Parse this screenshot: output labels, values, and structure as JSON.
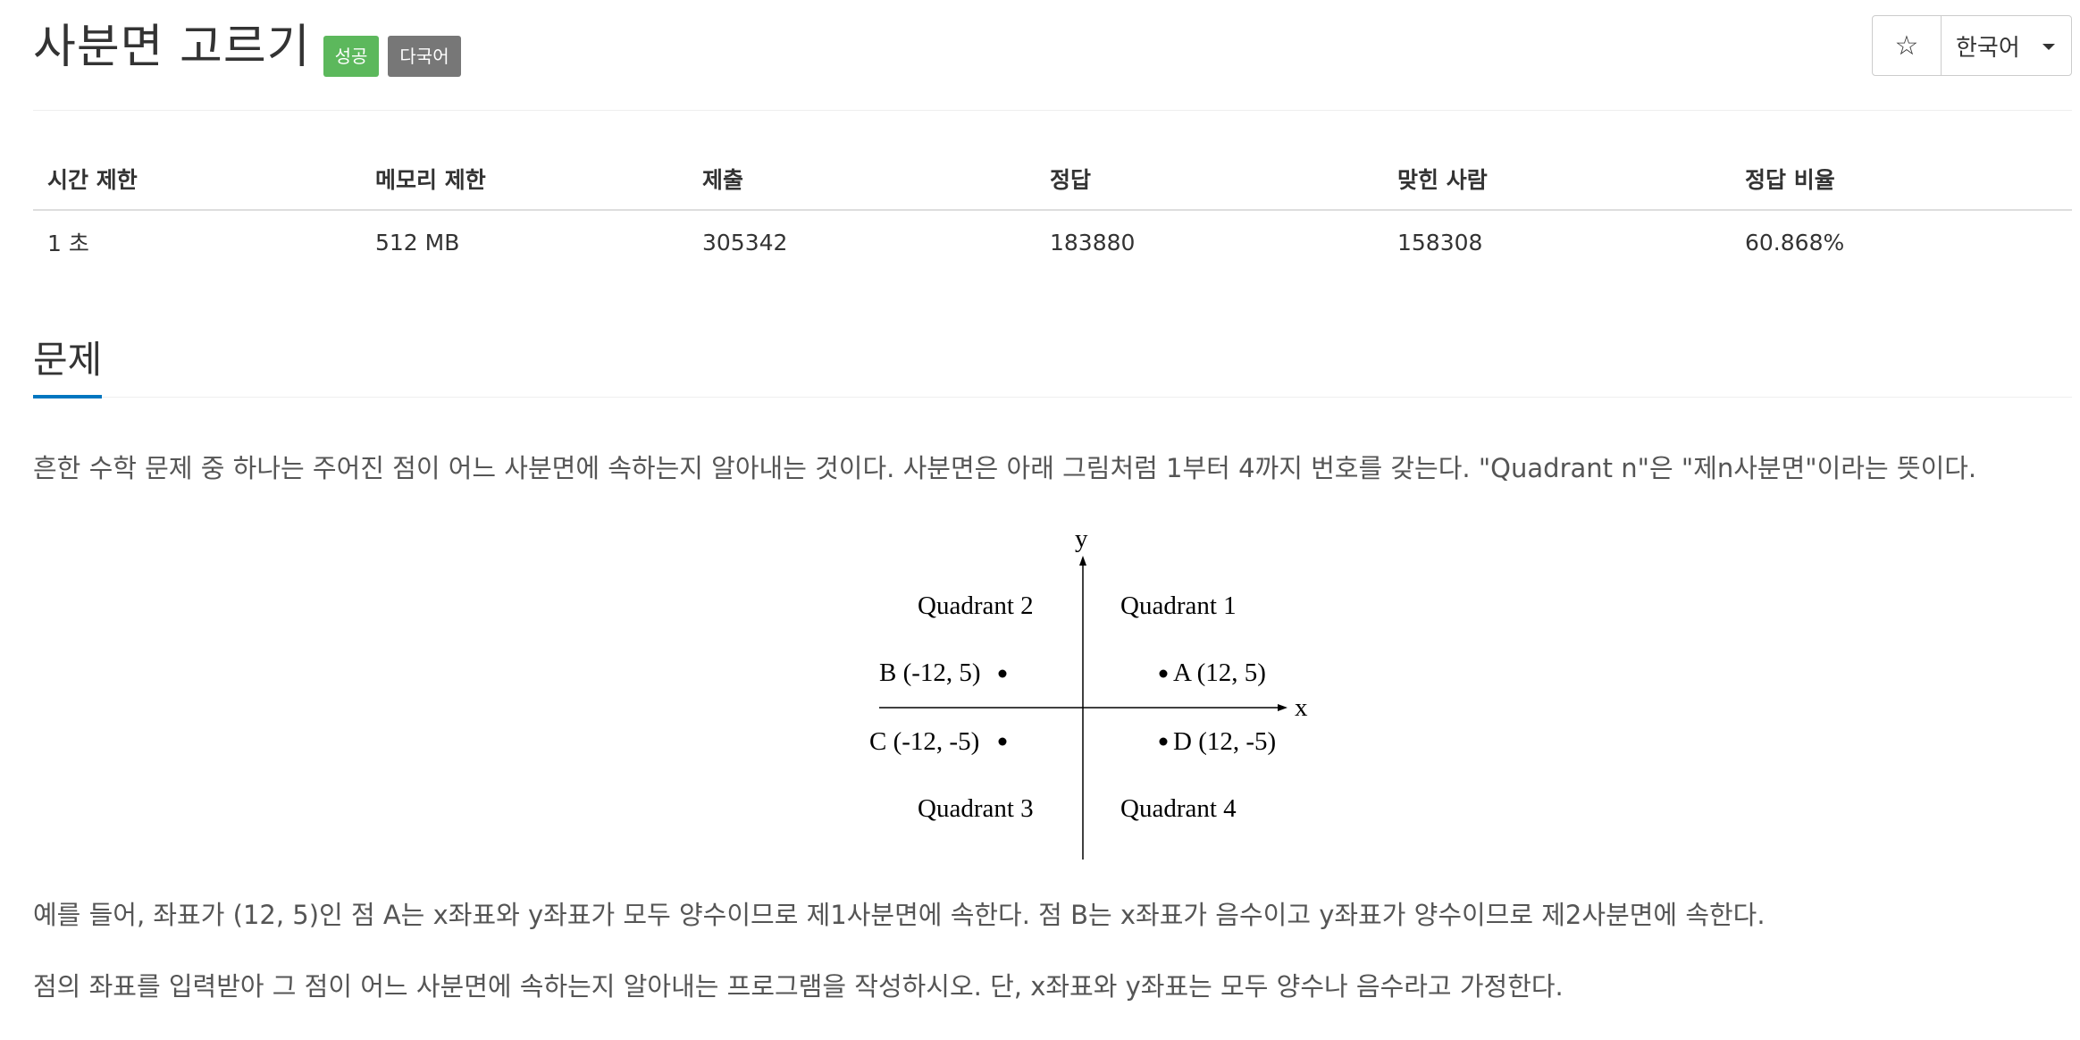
{
  "header": {
    "title": "사분면 고르기",
    "badges": {
      "success": "성공",
      "multilang": "다국어"
    },
    "star_icon": "☆",
    "language": "한국어"
  },
  "info_table": {
    "headers": [
      "시간 제한",
      "메모리 제한",
      "제출",
      "정답",
      "맞힌 사람",
      "정답 비율"
    ],
    "values": [
      "1 초",
      "512 MB",
      "305342",
      "183880",
      "158308",
      "60.868%"
    ]
  },
  "problem": {
    "heading": "문제",
    "paragraph1": "흔한 수학 문제 중 하나는 주어진 점이 어느 사분면에 속하는지 알아내는 것이다. 사분면은 아래 그림처럼 1부터 4까지 번호를 갖는다. \"Quadrant n\"은 \"제n사분면\"이라는 뜻이다.",
    "paragraph2": "예를 들어, 좌표가 (12, 5)인 점 A는 x좌표와 y좌표가 모두 양수이므로 제1사분면에 속한다. 점 B는 x좌표가 음수이고 y좌표가 양수이므로 제2사분면에 속한다.",
    "paragraph3": "점의 좌표를 입력받아 그 점이 어느 사분면에 속하는지 알아내는 프로그램을 작성하시오. 단, x좌표와 y좌표는 모두 양수나 음수라고 가정한다."
  },
  "diagram": {
    "x_axis_label": "x",
    "y_axis_label": "y",
    "quadrants": {
      "q1": "Quadrant 1",
      "q2": "Quadrant 2",
      "q3": "Quadrant 3",
      "q4": "Quadrant 4"
    },
    "points": {
      "a": "A (12, 5)",
      "b": "B (-12, 5)",
      "c": "C (-12, -5)",
      "d": "D (12, -5)"
    }
  },
  "colors": {
    "success_badge": "#5cb85c",
    "multilang_badge": "#777777",
    "section_underline": "#0076c0"
  }
}
